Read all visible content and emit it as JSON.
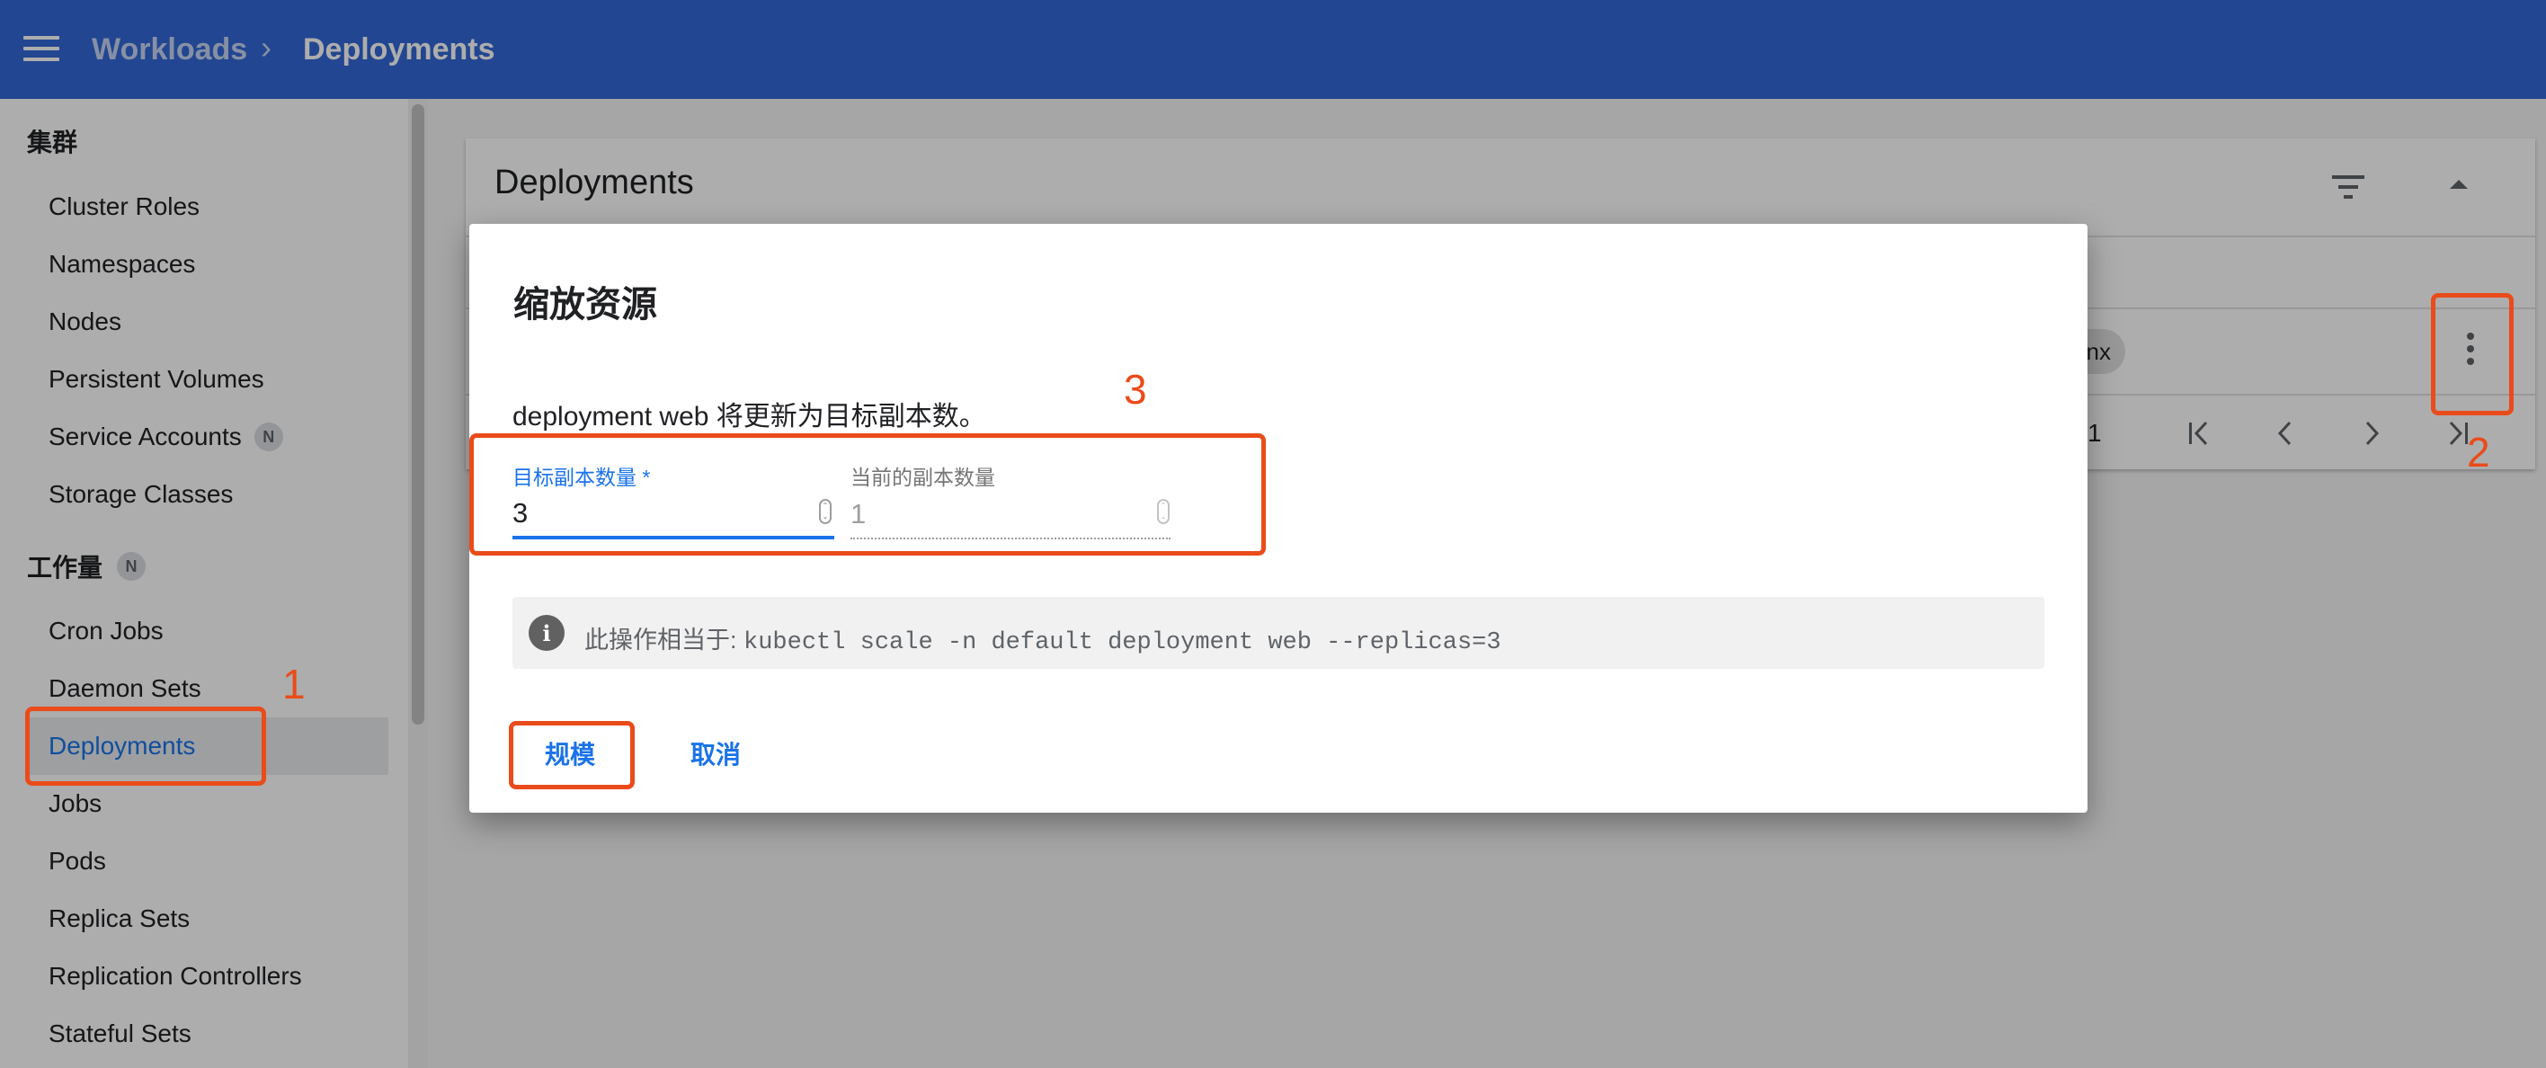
{
  "header": {
    "menu_icon": "hamburger-menu-icon",
    "breadcrumb_parent": "Workloads",
    "breadcrumb_sep": "›",
    "breadcrumb_current": "Deployments"
  },
  "sidebar": {
    "cluster_title": "集群",
    "cluster_items": [
      {
        "label": "Cluster Roles"
      },
      {
        "label": "Namespaces"
      },
      {
        "label": "Nodes"
      },
      {
        "label": "Persistent Volumes"
      },
      {
        "label": "Service Accounts",
        "badge": "N"
      },
      {
        "label": "Storage Classes"
      }
    ],
    "workloads_title": "工作量",
    "workloads_badge": "N",
    "workload_items": [
      {
        "label": "Cron Jobs"
      },
      {
        "label": "Daemon Sets"
      },
      {
        "label": "Deployments",
        "active": true
      },
      {
        "label": "Jobs"
      },
      {
        "label": "Pods"
      },
      {
        "label": "Replica Sets"
      },
      {
        "label": "Replication Controllers"
      },
      {
        "label": "Stateful Sets"
      }
    ]
  },
  "main": {
    "card_title": "Deployments",
    "filter_icon": "filter-icon",
    "collapse_icon": "collapse-up-icon",
    "row_chip_text": "nx",
    "row_menu_icon": "more-vert-icon",
    "page_number": "1",
    "pagination_icons": [
      "first-page-icon",
      "prev-page-icon",
      "next-page-icon",
      "last-page-icon"
    ]
  },
  "dialog": {
    "title": "缩放资源",
    "description": "deployment web 将更新为目标副本数。",
    "target_label": "目标副本数量 *",
    "target_value": "3",
    "current_label": "当前的副本数量",
    "current_value": "1",
    "info_icon": "info-icon",
    "info_prefix": "此操作相当于:",
    "info_command": "kubectl scale -n default deployment web --replicas=3",
    "scale_button": "规模",
    "cancel_button": "取消"
  },
  "annotations": [
    "1",
    "2",
    "3"
  ],
  "colors": {
    "topbar": "#3367d6",
    "accent": "#1a73e8",
    "annotation": "#ea4b1a"
  }
}
